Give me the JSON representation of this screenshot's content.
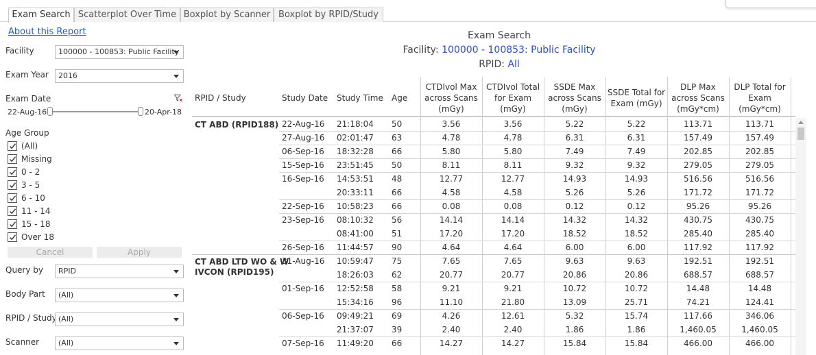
{
  "tabs": [
    "Exam Search",
    "Scatterplot Over Time",
    "Boxplot by Scanner",
    "Boxplot by RPID/Study"
  ],
  "corner_text": "",
  "about_link": "About this Report",
  "filters": {
    "facility_label": "Facility",
    "facility_value": "100000 - 100853: Public Facility",
    "exam_year_label": "Exam Year",
    "exam_year_value": "2016",
    "exam_date_label": "Exam Date",
    "date_start": "22-Aug-16",
    "date_end": "20-Apr-18",
    "age_group_label": "Age Group",
    "age_groups": [
      "(All)",
      "Missing",
      "0 - 2",
      "3 - 5",
      "6 - 10",
      "11 - 14",
      "15 - 18",
      "Over 18"
    ],
    "cancel_label": "Cancel",
    "apply_label": "Apply",
    "query_by_label": "Query by",
    "query_by_value": "RPID",
    "body_part_label": "Body Part",
    "body_part_value": "(All)",
    "rpid_study_label": "RPID / Study",
    "rpid_study_value": "(All)",
    "scanner_label": "Scanner",
    "scanner_value": "(All)"
  },
  "header": {
    "title": "Exam Search",
    "facility_prefix": "Facility:",
    "facility_value": "100000 - 100853: Public Facility",
    "rpid_prefix": "RPID:",
    "rpid_value": "All"
  },
  "table": {
    "columns": {
      "rpid": "RPID / Study",
      "study_date": "Study Date",
      "study_time": "Study Time",
      "age": "Age",
      "ctdi_max": [
        "CTDIvol Max",
        "across Scans",
        "(mGy)"
      ],
      "ctdi_total": [
        "CTDIvol Total",
        "for Exam",
        "(mGy)"
      ],
      "ssde_max": [
        "SSDE Max",
        "across Scans",
        "(mGy)"
      ],
      "ssde_total": [
        "SSDE Total for",
        "Exam (mGy)"
      ],
      "dlp_max": [
        "DLP Max",
        "across Scans",
        "(mGy*cm)"
      ],
      "dlp_total": [
        "DLP Total for",
        "Exam",
        "(mGy*cm)"
      ]
    },
    "groups": [
      {
        "rpid": [
          "CT ABD (RPID188)"
        ],
        "rows": [
          {
            "date": "22-Aug-16",
            "time": "21:18:04",
            "age": "50",
            "v": [
              "3.56",
              "3.56",
              "5.22",
              "5.22",
              "113.71",
              "113.71"
            ]
          },
          {
            "date": "27-Aug-16",
            "time": "02:01:47",
            "age": "63",
            "v": [
              "4.78",
              "4.78",
              "6.31",
              "6.31",
              "157.49",
              "157.49"
            ]
          },
          {
            "date": "06-Sep-16",
            "time": "18:32:28",
            "age": "66",
            "v": [
              "5.80",
              "5.80",
              "7.49",
              "7.49",
              "202.85",
              "202.85"
            ]
          },
          {
            "date": "15-Sep-16",
            "time": "23:51:45",
            "age": "50",
            "v": [
              "8.11",
              "8.11",
              "9.32",
              "9.32",
              "279.05",
              "279.05"
            ]
          },
          {
            "date": "16-Sep-16",
            "time": "14:53:51",
            "age": "48",
            "v": [
              "12.77",
              "12.77",
              "14.93",
              "14.93",
              "516.56",
              "516.56"
            ]
          },
          {
            "date": "",
            "time": "20:33:11",
            "age": "66",
            "v": [
              "4.58",
              "4.58",
              "5.26",
              "5.26",
              "171.72",
              "171.72"
            ]
          },
          {
            "date": "22-Sep-16",
            "time": "10:58:23",
            "age": "66",
            "v": [
              "0.08",
              "0.08",
              "0.12",
              "0.12",
              "95.26",
              "95.26"
            ]
          },
          {
            "date": "23-Sep-16",
            "time": "08:10:32",
            "age": "56",
            "v": [
              "14.14",
              "14.14",
              "14.32",
              "14.32",
              "430.75",
              "430.75"
            ]
          },
          {
            "date": "",
            "time": "08:41:00",
            "age": "51",
            "v": [
              "17.20",
              "17.20",
              "18.52",
              "18.52",
              "285.40",
              "285.40"
            ]
          },
          {
            "date": "26-Sep-16",
            "time": "11:44:57",
            "age": "90",
            "v": [
              "4.64",
              "4.64",
              "6.00",
              "6.00",
              "117.92",
              "117.92"
            ]
          }
        ]
      },
      {
        "rpid": [
          "CT ABD LTD WO & W",
          "IVCON (RPID195)"
        ],
        "rows": [
          {
            "date": "31-Aug-16",
            "time": "10:59:47",
            "age": "75",
            "v": [
              "7.65",
              "7.65",
              "9.63",
              "9.63",
              "192.51",
              "192.51"
            ]
          },
          {
            "date": "",
            "time": "18:26:03",
            "age": "62",
            "v": [
              "20.77",
              "20.77",
              "20.86",
              "20.86",
              "688.57",
              "688.57"
            ]
          },
          {
            "date": "01-Sep-16",
            "time": "12:52:58",
            "age": "58",
            "v": [
              "9.21",
              "9.21",
              "10.72",
              "10.72",
              "14.48",
              "14.48"
            ]
          },
          {
            "date": "",
            "time": "15:34:16",
            "age": "96",
            "v": [
              "11.10",
              "21.80",
              "13.09",
              "25.71",
              "74.21",
              "124.41"
            ]
          },
          {
            "date": "06-Sep-16",
            "time": "09:49:21",
            "age": "69",
            "v": [
              "4.26",
              "12.61",
              "5.32",
              "15.74",
              "117.66",
              "346.06"
            ]
          },
          {
            "date": "",
            "time": "21:37:07",
            "age": "39",
            "v": [
              "2.40",
              "2.40",
              "1.86",
              "1.86",
              "1,460.05",
              "1,460.05"
            ]
          },
          {
            "date": "07-Sep-16",
            "time": "11:49:20",
            "age": "66",
            "v": [
              "14.27",
              "14.27",
              "15.84",
              "15.84",
              "466.00",
              "466.00"
            ]
          }
        ]
      }
    ]
  }
}
